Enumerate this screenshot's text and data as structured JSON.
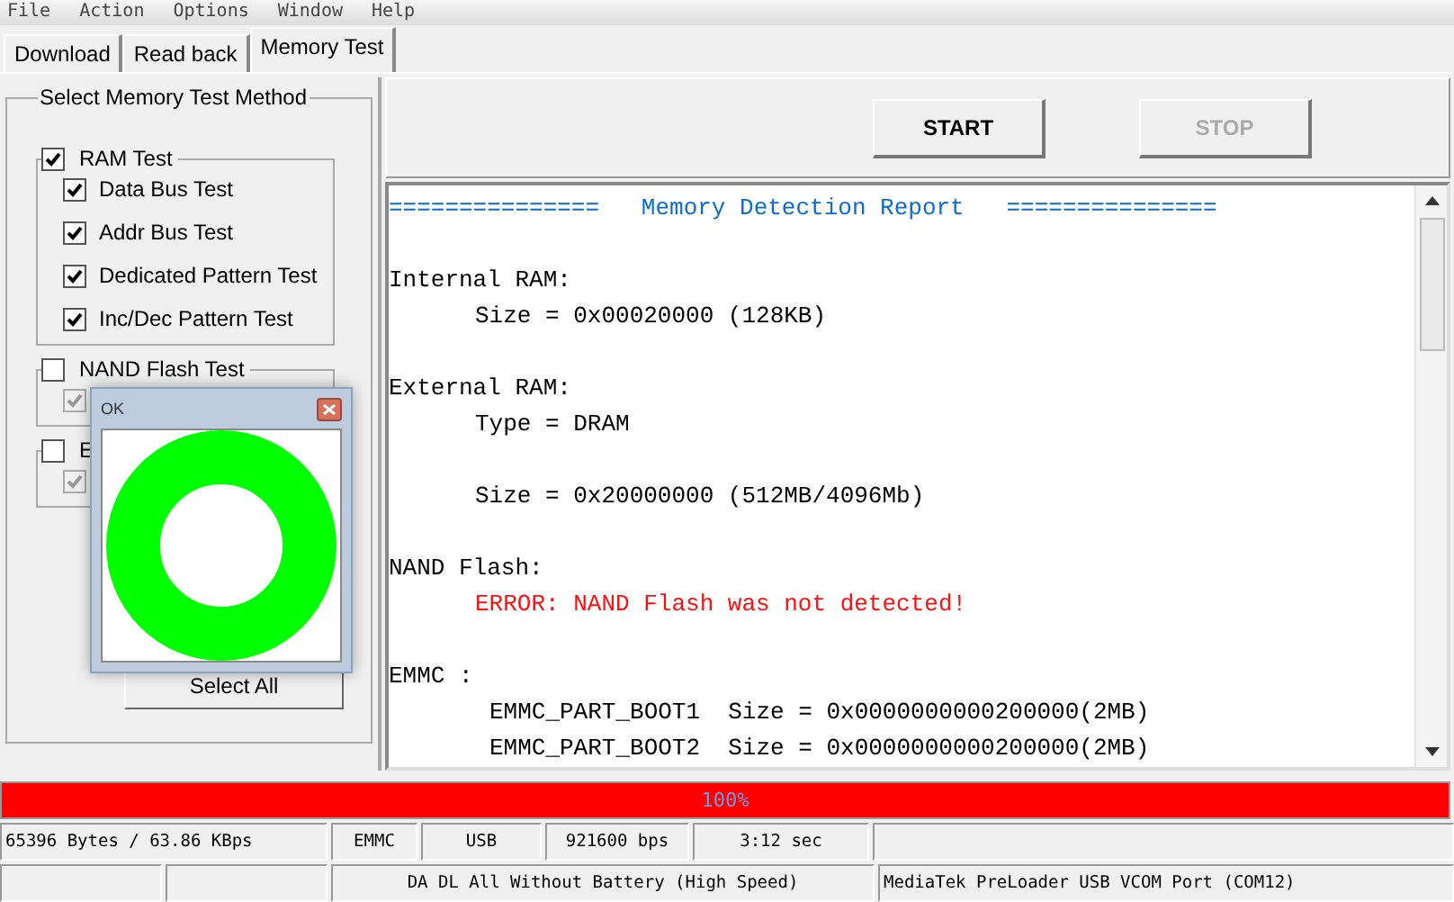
{
  "menu": [
    "File",
    "Action",
    "Options",
    "Window",
    "Help"
  ],
  "tabs": [
    {
      "label": "Download",
      "selected": false
    },
    {
      "label": "Read back",
      "selected": false
    },
    {
      "label": "Memory Test",
      "selected": true
    }
  ],
  "method_panel": {
    "title": "Select Memory Test Method",
    "groups": [
      {
        "label": "RAM Test",
        "checked": true,
        "children": [
          {
            "label": "Data Bus Test",
            "checked": true,
            "disabled": false
          },
          {
            "label": "Addr Bus Test",
            "checked": true,
            "disabled": false
          },
          {
            "label": "Dedicated Pattern Test",
            "checked": true,
            "disabled": false
          },
          {
            "label": "Inc/Dec Pattern Test",
            "checked": true,
            "disabled": false
          }
        ]
      },
      {
        "label": "NAND Flash Test",
        "checked": false,
        "children": [
          {
            "checked": true,
            "disabled": true
          }
        ]
      },
      {
        "label": "E",
        "checked": false,
        "children": [
          {
            "checked": true,
            "disabled": true
          }
        ]
      }
    ],
    "select_all": "Select All"
  },
  "buttons": [
    {
      "label": "START",
      "disabled": false
    },
    {
      "label": "STOP",
      "disabled": true
    }
  ],
  "report": [
    {
      "kind": "heading",
      "text": "===============   Memory Detection Report   ==============="
    },
    {
      "kind": "blank"
    },
    {
      "kind": "label",
      "text": "Internal RAM:"
    },
    {
      "kind": "value",
      "text": "Size = 0x00020000 (128KB)"
    },
    {
      "kind": "blank"
    },
    {
      "kind": "label",
      "text": "External RAM:"
    },
    {
      "kind": "value",
      "text": "Type = DRAM"
    },
    {
      "kind": "blank"
    },
    {
      "kind": "value",
      "text": "Size = 0x20000000 (512MB/4096Mb)"
    },
    {
      "kind": "blank"
    },
    {
      "kind": "label",
      "text": "NAND Flash:"
    },
    {
      "kind": "error",
      "text": "ERROR: NAND Flash was not detected!"
    },
    {
      "kind": "blank"
    },
    {
      "kind": "label",
      "text": "EMMC :"
    },
    {
      "kind": "entry",
      "text": "EMMC_PART_BOOT1  Size = 0x0000000000200000(2MB)"
    },
    {
      "kind": "entry",
      "text": "EMMC_PART_BOOT2  Size = 0x0000000000200000(2MB)"
    }
  ],
  "progress": {
    "level": 1,
    "text": "100%"
  },
  "status_bar": {
    "row_1": [
      "65396 Bytes / 63.86 KBps",
      "EMMC",
      "USB",
      "921600 bps",
      "3:12 sec"
    ],
    "row_2": [
      "DA DL All Without Battery (High Speed)",
      "MediaTek PreLoader USB VCOM Port (COM12)"
    ]
  },
  "popup": {
    "title": "OK"
  }
}
